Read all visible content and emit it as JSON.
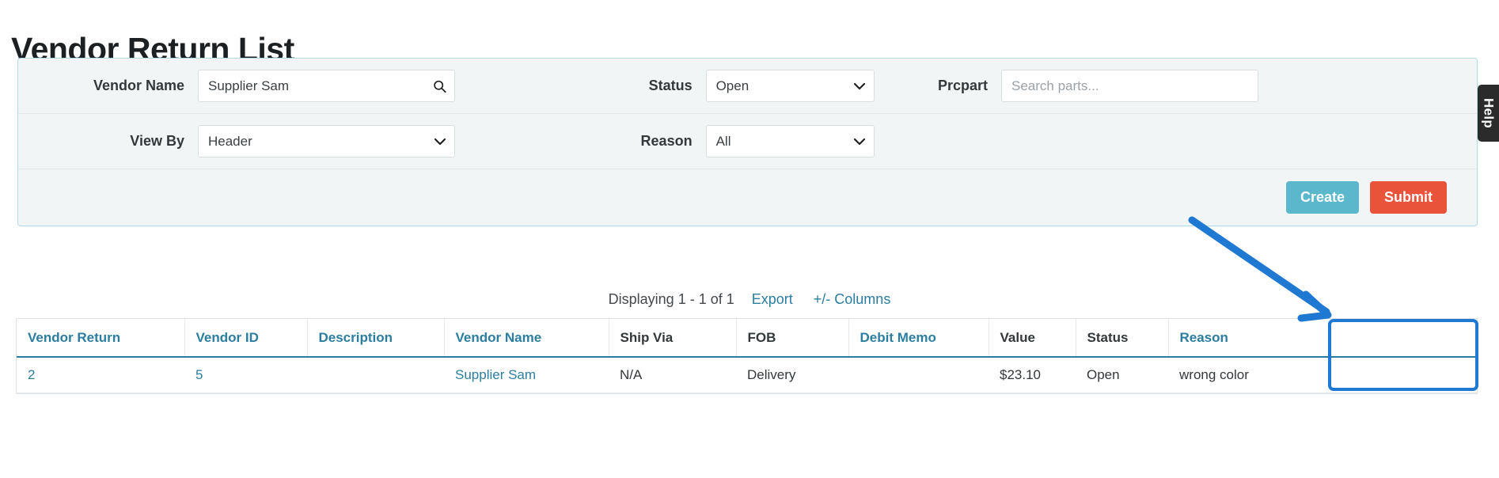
{
  "page_title": "Vendor Return List",
  "filters": {
    "vendor_name": {
      "label": "Vendor Name",
      "value": "Supplier Sam",
      "icon": "search-icon"
    },
    "status": {
      "label": "Status",
      "value": "Open",
      "icon": "chevron-down-icon"
    },
    "prcpart": {
      "label": "Prcpart",
      "value": "",
      "placeholder": "Search parts..."
    },
    "view_by": {
      "label": "View By",
      "value": "Header",
      "icon": "chevron-down-icon"
    },
    "reason": {
      "label": "Reason",
      "value": "All",
      "icon": "chevron-down-icon"
    },
    "buttons": {
      "create": "Create",
      "submit": "Submit"
    }
  },
  "pager": {
    "displaying": "Displaying 1 - 1 of 1",
    "export": "Export",
    "columns": "+/- Columns"
  },
  "table": {
    "columns": [
      {
        "label": "Vendor Return",
        "link": true
      },
      {
        "label": "Vendor ID",
        "link": true
      },
      {
        "label": "Description",
        "link": true
      },
      {
        "label": "Vendor Name",
        "link": true
      },
      {
        "label": "Ship Via",
        "link": false
      },
      {
        "label": "FOB",
        "link": false
      },
      {
        "label": "Debit Memo",
        "link": true
      },
      {
        "label": "Value",
        "link": false
      },
      {
        "label": "Status",
        "link": false
      },
      {
        "label": "Reason",
        "link": true
      }
    ],
    "rows": [
      {
        "vendor_return": "2",
        "vendor_id": "5",
        "description": "",
        "vendor_name": "Supplier Sam",
        "ship_via": "N/A",
        "fob": "Delivery",
        "debit_memo": "",
        "value": "$23.10",
        "status": "Open",
        "reason": "wrong color"
      }
    ]
  },
  "help_tab": {
    "label": "Help"
  },
  "colors": {
    "link": "#2c7ea1",
    "create_button": "#5bb8cc",
    "submit_button": "#e8533a",
    "annotation": "#1f78d1",
    "panel_bg": "#f1f5f6",
    "panel_border": "#aedbe6",
    "help_tab_bg": "#2b2b2b"
  }
}
